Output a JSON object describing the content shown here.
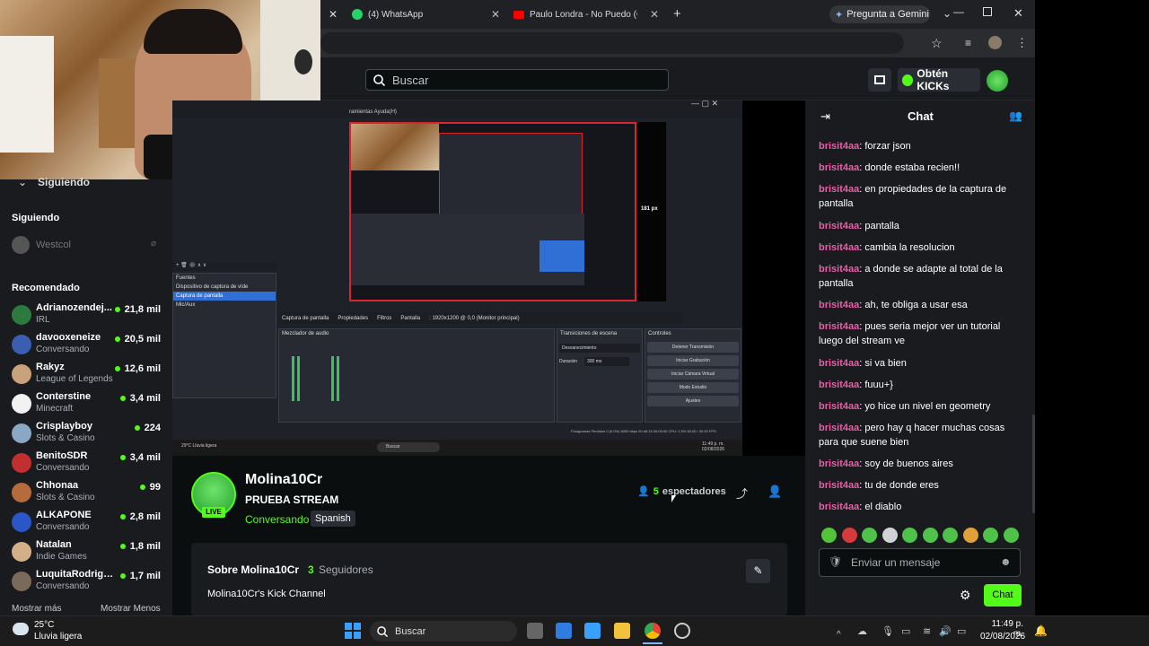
{
  "browser": {
    "tabs": [
      {
        "label": "(4) WhatsApp"
      },
      {
        "label": "Paulo Londra - No Puedo (Offi"
      }
    ],
    "gemini_label": "Pregunta a Gemini"
  },
  "header": {
    "search_placeholder": "Buscar",
    "kicks_label": "Obtén KICKs"
  },
  "sidebar": {
    "following_top": "Siguiendo",
    "following_title": "Siguiendo",
    "following_items": [
      {
        "name": "Westcol"
      }
    ],
    "recommended_title": "Recomendado",
    "recommended": [
      {
        "name": "Adrianozendej...",
        "category": "IRL",
        "viewers": "21,8 mil",
        "color": "#2d7a3e"
      },
      {
        "name": "davooxeneize",
        "category": "Conversando",
        "viewers": "20,5 mil",
        "color": "#3a5fb0"
      },
      {
        "name": "Rakyz",
        "category": "League of Legends",
        "viewers": "12,6 mil",
        "color": "#c9a27c"
      },
      {
        "name": "Conterstine",
        "category": "Minecraft",
        "viewers": "3,4 mil",
        "color": "#f2f2f2"
      },
      {
        "name": "Crisplayboy",
        "category": "Slots & Casino",
        "viewers": "224",
        "color": "#8aa7c4"
      },
      {
        "name": "BenitoSDR",
        "category": "Conversando",
        "viewers": "3,4 mil",
        "color": "#c22f2f"
      },
      {
        "name": "Chhonaa",
        "category": "Slots & Casino",
        "viewers": "99",
        "color": "#b56b3a"
      },
      {
        "name": "ALKAPONE",
        "category": "Conversando",
        "viewers": "2,8 mil",
        "color": "#2a56c8"
      },
      {
        "name": "Natalan",
        "category": "Indie Games",
        "viewers": "1,8 mil",
        "color": "#d4b08a"
      },
      {
        "name": "LuquitaRodriguez",
        "category": "Conversando",
        "viewers": "1,7 mil",
        "color": "#7a6a5a"
      }
    ],
    "show_more": "Mostrar más",
    "show_less": "Mostrar Menos"
  },
  "obs": {
    "menu": "ramientas   Ayuda(H)",
    "sources_title": "Fuentes",
    "sources": [
      "Dispositivo de captura de víde",
      "Captura de pantalla",
      "Mic/Aux"
    ],
    "capture_bar": "Captura de pantalla",
    "properties": "Propiedades",
    "filters": "Filtros",
    "screen_label": "Pantalla",
    "screen_value": ": 1920x1200 @ 0,0 (Monitor principal)",
    "mixer_title": "Mezclador de audio",
    "transitions_title": "Transiciones de escena",
    "transition_value": "Desvanecimiento",
    "duration_label": "Duración",
    "duration_value": "300 ms",
    "controls_title": "Controles",
    "controls": [
      "Detener Transmisión",
      "Iniciar Grabación",
      "Iniciar Cámara Virtual",
      "Modo Estudio",
      "Ajustes"
    ],
    "status": "Fotogramas Perdidos 0 (0.0%)   6059 kbps   00:46:15   00:00:00   CPU: 1.5%   30.00 / 30.00 FPS",
    "px_label": "181 px",
    "weather": "29°C Lluvia ligera",
    "search": "Buscar",
    "time": "11:49 p. m. 02/08/2026"
  },
  "channel": {
    "name": "Molina10Cr",
    "title": "PRUEBA STREAM",
    "category": "Conversando",
    "language": "Spanish",
    "live": "LIVE",
    "viewers": "5",
    "viewers_label": "espectadores",
    "about_prefix": "Sobre Molina10Cr",
    "followers_count": "3",
    "followers_label": "Seguidores",
    "description": "Molina10Cr's Kick Channel"
  },
  "chat": {
    "title": "Chat",
    "messages": [
      {
        "user": "brisit4aa",
        "text": ": forzar json"
      },
      {
        "user": "brisit4aa",
        "text": ": donde estaba recien!!"
      },
      {
        "user": "brisit4aa",
        "text": ": en propiedades de la captura de pantalla"
      },
      {
        "user": "brisit4aa",
        "text": ": pantalla"
      },
      {
        "user": "brisit4aa",
        "text": ": cambia la resolucion"
      },
      {
        "user": "brisit4aa",
        "text": ": a donde se adapte al total de la pantalla"
      },
      {
        "user": "brisit4aa",
        "text": ": ah, te obliga a usar esa"
      },
      {
        "user": "brisit4aa",
        "text": ": pues seria mejor ver un tutorial luego del stream ve"
      },
      {
        "user": "brisit4aa",
        "text": ": si va bien"
      },
      {
        "user": "brisit4aa",
        "text": ": fuuu+}"
      },
      {
        "user": "brisit4aa",
        "text": ": yo hice un nivel en geometry"
      },
      {
        "user": "brisit4aa",
        "text": ": pero hay q hacer muchas cosas para que suene bien"
      },
      {
        "user": "brisit4aa",
        "text": ": soy de buenos aires"
      },
      {
        "user": "brisit4aa",
        "text": ": tu de donde eres"
      },
      {
        "user": "brisit4aa",
        "text": ": el diablo"
      }
    ],
    "input_placeholder": "Enviar un mensaje",
    "send_label": "Chat"
  },
  "taskbar": {
    "weather_temp": "25°C",
    "weather_desc": "Lluvia ligera",
    "search": "Buscar",
    "time": "11:49 p. m.",
    "date": "02/08/2026"
  }
}
